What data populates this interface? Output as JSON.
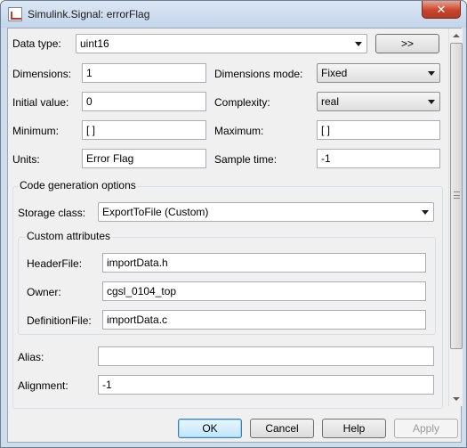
{
  "window": {
    "title": "Simulink.Signal: errorFlag",
    "close_symbol": "✕"
  },
  "fields": {
    "data_type": {
      "label": "Data type:",
      "value": "uint16",
      "expand_button": ">>"
    },
    "dimensions": {
      "label": "Dimensions:",
      "value": "1"
    },
    "dimensions_mode": {
      "label": "Dimensions mode:",
      "value": "Fixed"
    },
    "initial_value": {
      "label": "Initial value:",
      "value": "0"
    },
    "complexity": {
      "label": "Complexity:",
      "value": "real"
    },
    "minimum": {
      "label": "Minimum:",
      "value": "[ ]"
    },
    "maximum": {
      "label": "Maximum:",
      "value": "[ ]"
    },
    "units": {
      "label": "Units:",
      "value": "Error Flag"
    },
    "sample_time": {
      "label": "Sample time:",
      "value": "-1"
    }
  },
  "code_gen": {
    "title": "Code generation options",
    "storage_class": {
      "label": "Storage class:",
      "value": "ExportToFile (Custom)"
    },
    "custom_attributes": {
      "title": "Custom attributes",
      "header_file": {
        "label": "HeaderFile:",
        "value": "importData.h"
      },
      "owner": {
        "label": "Owner:",
        "value": "cgsl_0104_top"
      },
      "definition_file": {
        "label": "DefinitionFile:",
        "value": "importData.c"
      }
    },
    "alias": {
      "label": "Alias:",
      "value": ""
    },
    "alignment": {
      "label": "Alignment:",
      "value": "-1"
    }
  },
  "buttons": {
    "ok": "OK",
    "cancel": "Cancel",
    "help": "Help",
    "apply": "Apply"
  }
}
